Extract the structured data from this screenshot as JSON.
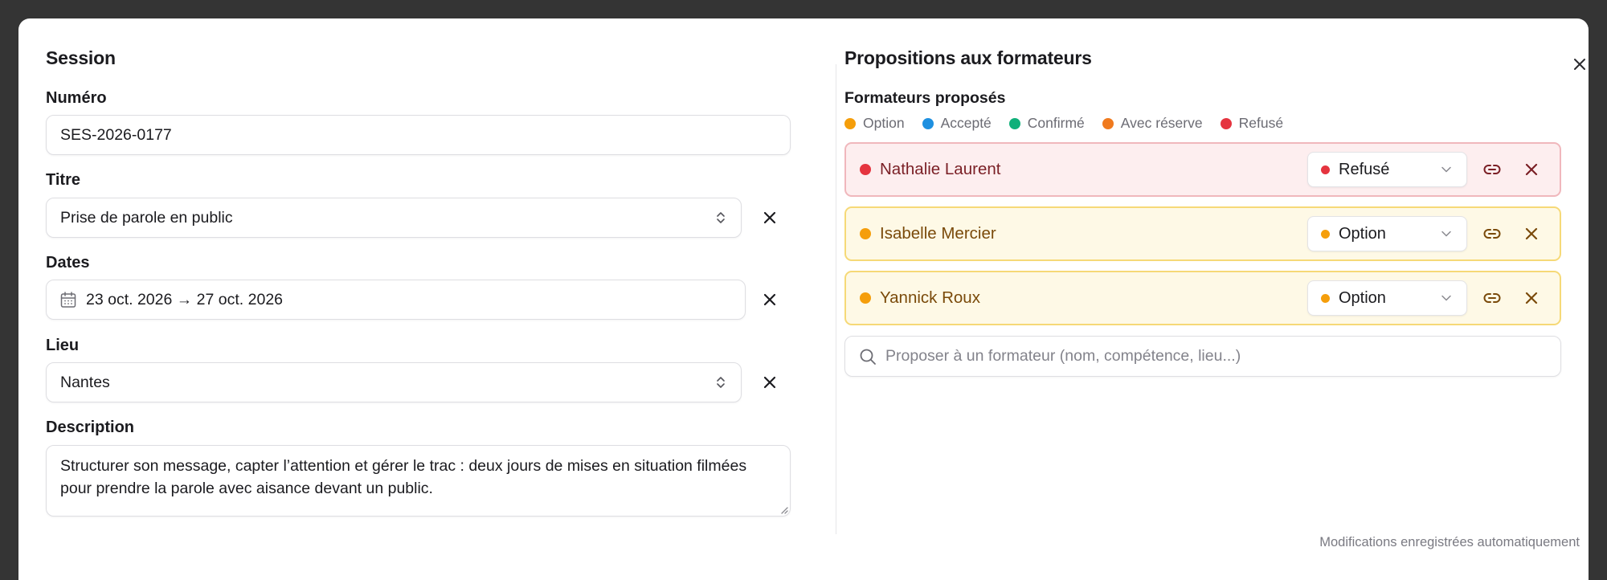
{
  "session": {
    "title": "Session",
    "numero": {
      "label": "Numéro",
      "value": "SES-2026-0177"
    },
    "titre": {
      "label": "Titre",
      "value": "Prise de parole en public"
    },
    "dates": {
      "label": "Dates",
      "value": "23 oct. 2026 → 27 oct. 2026"
    },
    "lieu": {
      "label": "Lieu",
      "value": "Nantes"
    },
    "description": {
      "label": "Description",
      "value": "Structurer son message, capter l’attention et gérer le trac : deux jours de mises en situation filmées pour prendre la parole avec aisance devant un public."
    }
  },
  "propositions": {
    "title": "Propositions aux formateurs",
    "subtitle": "Formateurs proposés",
    "legend": [
      {
        "label": "Option",
        "color": "#F59E0B"
      },
      {
        "label": "Accepté",
        "color": "#1E90E0"
      },
      {
        "label": "Confirmé",
        "color": "#10B07A"
      },
      {
        "label": "Avec réserve",
        "color": "#F07A1E"
      },
      {
        "label": "Refusé",
        "color": "#E5343F"
      }
    ],
    "rows": [
      {
        "name": "Nathalie Laurent",
        "status": "Refusé",
        "status_color": "#E5343F",
        "bg": "#FDEEEF",
        "border": "#F0B7BC",
        "text_color": "#7A1F25"
      },
      {
        "name": "Isabelle Mercier",
        "status": "Option",
        "status_color": "#F59E0B",
        "bg": "#FEF9E6",
        "border": "#F6D977",
        "text_color": "#7A4A0A"
      },
      {
        "name": "Yannick Roux",
        "status": "Option",
        "status_color": "#F59E0B",
        "bg": "#FEF9E6",
        "border": "#F6D977",
        "text_color": "#7A4A0A"
      }
    ],
    "search_placeholder": "Proposer à un formateur (nom, compétence, lieu...)"
  },
  "footer": {
    "autosave": "Modifications enregistrées automatiquement"
  }
}
